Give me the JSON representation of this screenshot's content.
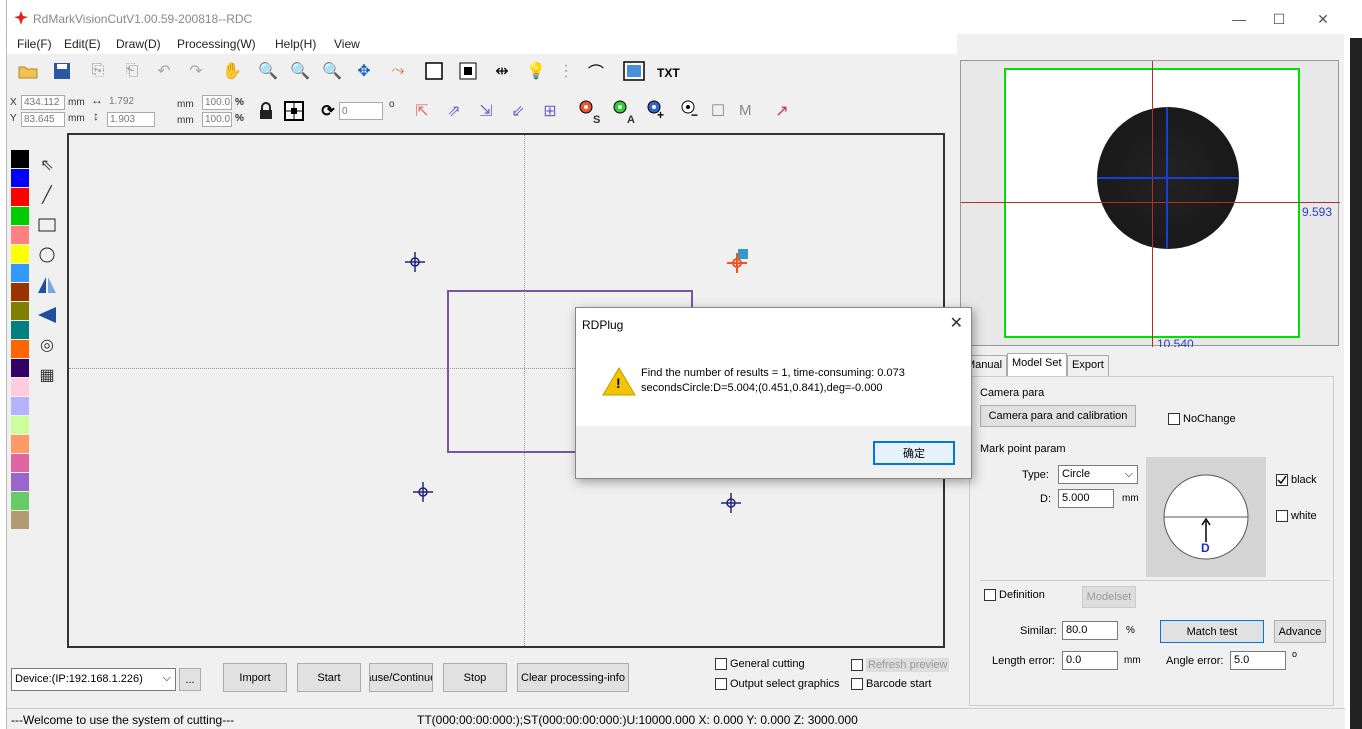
{
  "window": {
    "title": "RdMarkVisionCutV1.00.59-200818--RDC",
    "minimize": "—",
    "maximize": "☐",
    "close": "✕"
  },
  "menu": [
    "File(F)",
    "Edit(E)",
    "Draw(D)",
    "Processing(W)",
    "Help(H)",
    "View"
  ],
  "toolbar": {
    "txt_label": "TXT"
  },
  "coords": {
    "x_label": "X",
    "y_label": "Y",
    "x": "434.112",
    "y": "83.645",
    "w": "1.792",
    "h": "1.903",
    "unit": "mm",
    "scale_x": "100.0",
    "scale_y": "100.0",
    "pct": "%",
    "rotate": "0",
    "deg": "o",
    "tool_s": "S",
    "tool_a": "A",
    "tool_m": "M"
  },
  "palette": [
    "#000000",
    "#0000ff",
    "#ff0000",
    "#00cc00",
    "#ff8080",
    "#ffff00",
    "#3399ff",
    "#993300",
    "#808000",
    "#008080",
    "#ff6600",
    "#330066",
    "#ffccdd",
    "#b3b3ff",
    "#ccff99",
    "#ff9966",
    "#e066a3",
    "#9966cc",
    "#66cc66",
    "#b39b73"
  ],
  "dialog": {
    "title": "RDPlug",
    "close": "✕",
    "line1": "Find the number of results = 1, time-consuming: 0.073",
    "line2": "secondsCircle:D=5.004;(0.451,0.841),deg=-0.000",
    "ok": "确定",
    "warn_glyph": "!"
  },
  "bottom": {
    "device": "Device:(IP:192.168.1.226)",
    "device_dropdown": "⌵",
    "more": "...",
    "import": "Import",
    "start": "Start",
    "pause": "Pause/Continue",
    "stop": "Stop",
    "clear": "Clear processing-info",
    "general_cutting": "General cutting",
    "output_select": "Output select graphics",
    "refresh_preview": "Refresh preview",
    "barcode_start": "Barcode start"
  },
  "status": {
    "welcome": "---Welcome to use the system of cutting---",
    "info": "TT(000:00:00:000:);ST(000:00:00:000:)U:10000.000 X: 0.000   Y: 0.000   Z: 3000.000"
  },
  "camera": {
    "measure_right": "9.593",
    "measure_bottom": "10.540"
  },
  "tabs": [
    "Manual",
    "Model Set",
    "Export"
  ],
  "panel": {
    "camera_para_group": "Camera para",
    "camera_para_btn": "Camera para and calibration",
    "nochange": "NoChange",
    "mark_group": "Mark point param",
    "type_label": "Type:",
    "type_value": "Circle",
    "select_arrow": "⌵",
    "d_label": "D:",
    "d_value": "5.000",
    "mm": "mm",
    "black": "black",
    "white": "white",
    "diagram_label": "D",
    "definition": "Definition",
    "modelset": "Modelset",
    "similar_label": "Similar:",
    "similar_value": "80.0",
    "pct": "%",
    "match_test": "Match test",
    "advance": "Advance",
    "length_error_label": "Length error:",
    "length_error_value": "0.0",
    "angle_error_label": "Angle error:",
    "angle_error_value": "5.0",
    "deg": "o"
  }
}
